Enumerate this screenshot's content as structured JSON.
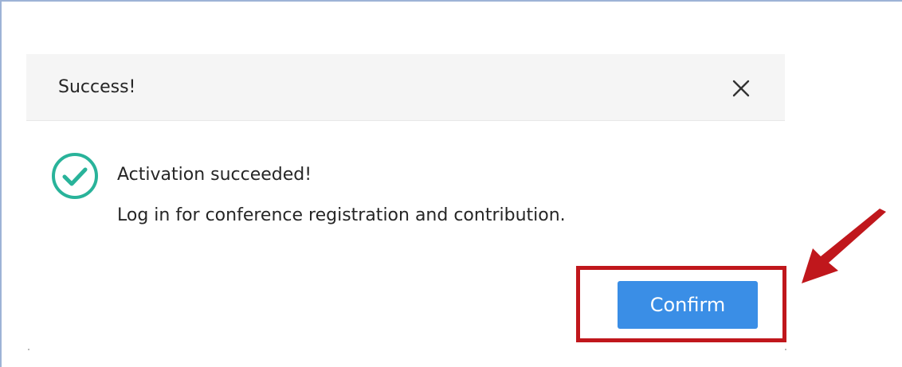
{
  "dialog": {
    "title": "Success!",
    "message_title": "Activation succeeded!",
    "message_body": "Log in for conference registration and contribution.",
    "confirm_label": "Confirm"
  },
  "icons": {
    "close": "close-icon",
    "success": "check-circle-icon",
    "annotation_arrow": "arrow-icon"
  },
  "colors": {
    "header_bg": "#f5f5f5",
    "success_green": "#29b39a",
    "confirm_blue": "#3a8ee6",
    "highlight_red": "#c0171c",
    "text": "#262626"
  }
}
